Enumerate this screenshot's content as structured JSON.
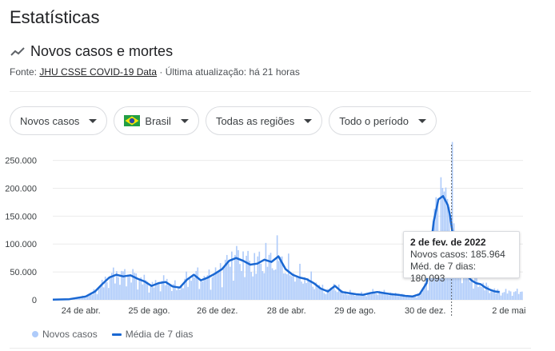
{
  "page": {
    "title": "Estatísticas"
  },
  "section": {
    "title": "Novos casos e mortes",
    "source_prefix": "Fonte: ",
    "source_link": "JHU CSSE COVID-19 Data",
    "source_suffix": " · Última atualização: há 21 horas"
  },
  "filters": [
    {
      "label": "Novos casos"
    },
    {
      "label": "Brasil",
      "icon": "brazil-flag-icon"
    },
    {
      "label": "Todas as regiões"
    },
    {
      "label": "Todo o período"
    }
  ],
  "tooltip": {
    "date": "2 de fev. de 2022",
    "cases": "Novos casos: 185.964",
    "avg": "Méd. de 7 dias: 180.093"
  },
  "legend": {
    "cases": "Novos casos",
    "avg": "Média de 7 dias"
  },
  "colors": {
    "bars": "#aecbfa",
    "avg_line": "#1967d2",
    "grid": "#ebebeb"
  },
  "chart_data": {
    "type": "bar",
    "title": "",
    "xlabel": "",
    "ylabel": "",
    "ylim": [
      0,
      250000
    ],
    "y_ticks": [
      "0",
      "50.000",
      "100.000",
      "150.000",
      "200.000",
      "250.000"
    ],
    "y_tick_values": [
      0,
      50000,
      100000,
      150000,
      200000,
      250000
    ],
    "x_tick_labels": [
      "24 de abr.",
      "25 de ago.",
      "26 de dez.",
      "28 de abr.",
      "29 de ago.",
      "30 de dez.",
      "2 de mai"
    ],
    "x_tick_fractions": [
      0.06,
      0.205,
      0.35,
      0.497,
      0.643,
      0.792,
      0.97
    ],
    "series": [
      {
        "name": "Média de 7 dias",
        "kind": "line",
        "x": [
          0.0,
          0.035,
          0.07,
          0.09,
          0.105,
          0.12,
          0.135,
          0.15,
          0.165,
          0.18,
          0.195,
          0.21,
          0.225,
          0.24,
          0.255,
          0.27,
          0.285,
          0.3,
          0.315,
          0.33,
          0.345,
          0.36,
          0.375,
          0.39,
          0.405,
          0.42,
          0.435,
          0.45,
          0.465,
          0.48,
          0.495,
          0.51,
          0.525,
          0.54,
          0.555,
          0.57,
          0.585,
          0.6,
          0.615,
          0.63,
          0.645,
          0.66,
          0.675,
          0.69,
          0.705,
          0.72,
          0.735,
          0.75,
          0.765,
          0.78,
          0.795,
          0.81,
          0.82,
          0.83,
          0.84,
          0.845,
          0.85,
          0.855,
          0.86,
          0.87,
          0.88,
          0.89,
          0.9,
          0.91,
          0.92,
          0.93,
          0.94,
          0.95
        ],
        "values": [
          500,
          1200,
          6000,
          15000,
          28000,
          40000,
          45000,
          42000,
          44000,
          38000,
          33000,
          25000,
          30000,
          32000,
          24000,
          22000,
          36000,
          45000,
          35000,
          40000,
          47000,
          55000,
          70000,
          75000,
          70000,
          63000,
          65000,
          72000,
          68000,
          78000,
          55000,
          45000,
          40000,
          37000,
          30000,
          20000,
          15000,
          25000,
          14000,
          12000,
          10000,
          9000,
          12000,
          14000,
          12000,
          10000,
          9000,
          7000,
          6000,
          10000,
          30000,
          140000,
          180000,
          186000,
          170000,
          150000,
          120000,
          100000,
          80000,
          60000,
          45000,
          35000,
          30000,
          28000,
          22000,
          18000,
          15000,
          14000
        ]
      },
      {
        "name": "Novos casos",
        "kind": "bar",
        "peak_x": 0.848,
        "peak_value": 283000
      }
    ],
    "marker_x": 0.848,
    "grid": true,
    "legend_position": "bottom-left"
  }
}
